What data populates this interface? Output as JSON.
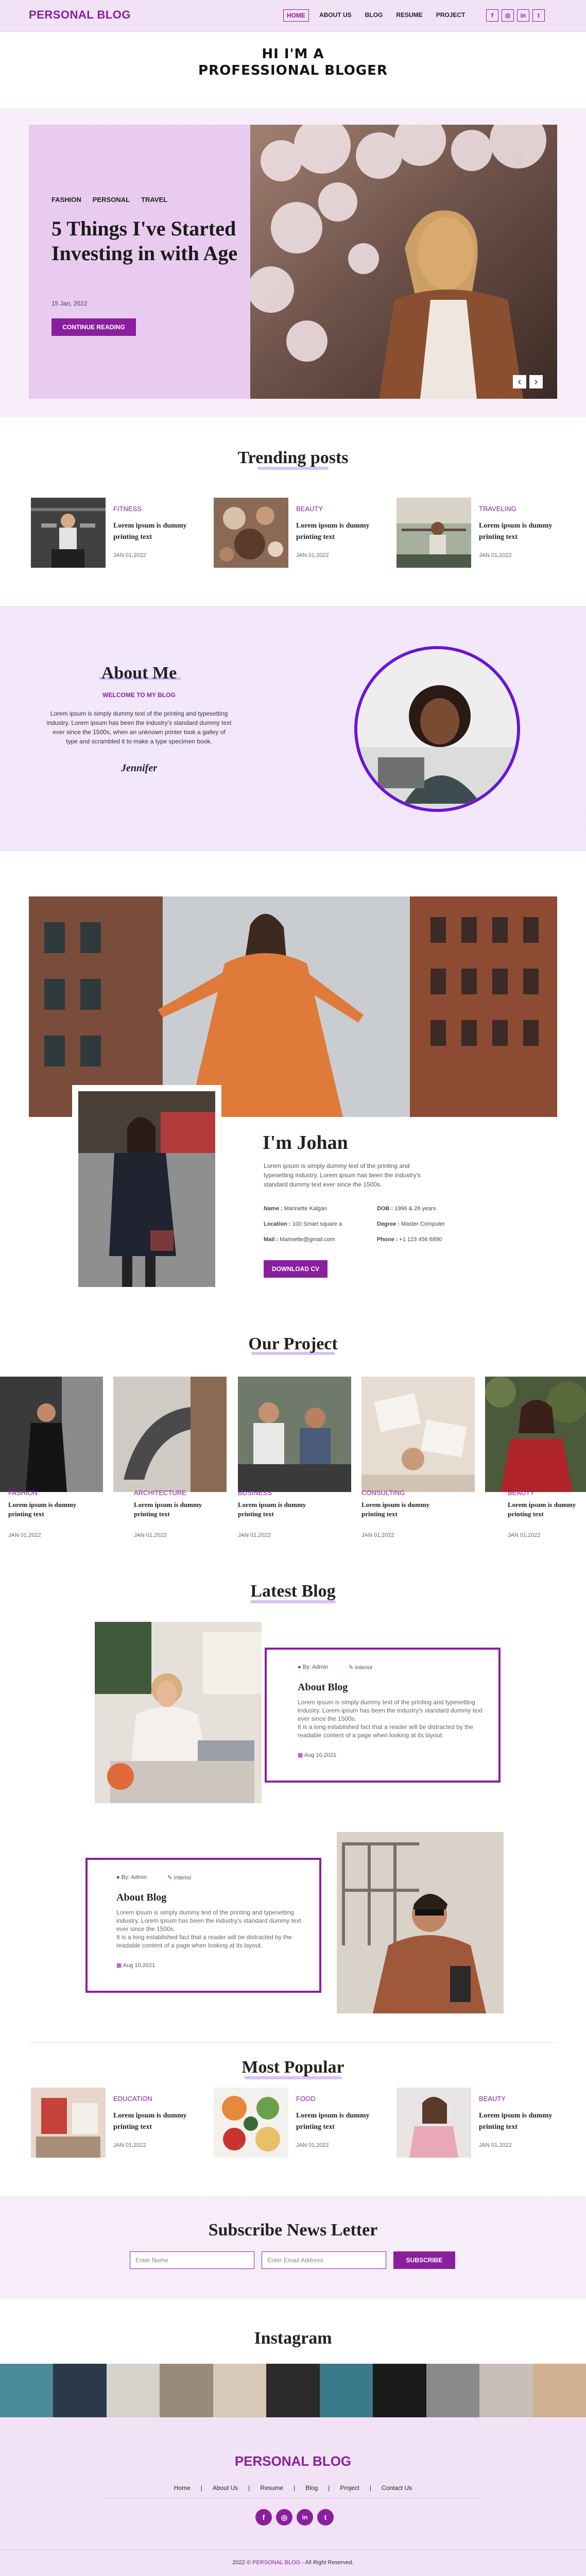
{
  "header": {
    "logo": "PERSONAL BLOG",
    "nav": [
      "HOME",
      "ABOUT US",
      "BLOG",
      "RESUME",
      "PROJECT"
    ],
    "social": [
      "f",
      "◎",
      "in",
      "t"
    ]
  },
  "intro": {
    "line1": "HI I'M A",
    "line2": "PROFESSIONAL BLOGER"
  },
  "hero": {
    "tags": [
      "FASHION",
      "PERSONAL",
      "TRAVEL"
    ],
    "title": "5 Things I've Started Investing in with Age",
    "date": "15 Jan, 2022",
    "button": "CONTINUE READING",
    "prev": "‹",
    "next": "›"
  },
  "trending": {
    "title": "Trending posts",
    "posts": [
      {
        "category": "FITNESS",
        "title": "Lorem ipsum is dummy printing text",
        "date": "JAN 01,2022"
      },
      {
        "category": "BEAUTY",
        "title": "Lorem ipsum is dummy printing text",
        "date": "JAN 01,2022"
      },
      {
        "category": "TRAVELING",
        "title": "Lorem ipsum is dummy printing text",
        "date": "JAN 01,2022"
      }
    ]
  },
  "about": {
    "title": "About Me",
    "subtitle": "WELCOME TO MY BLOG",
    "text": "Lorem ipsum is simply dummy text of the printing and typesetting industry. Lorem ipsum has been the industry's standard dummy text ever since the 1500s, when an unknown printer took a galley of type and scrambled it to make a type specimen book.",
    "signature": "Jennifer"
  },
  "resume": {
    "name": "I'm Johan",
    "text": "Lorem ipsum is simply dummy text of the printing and typesetting industry. Lorem ipsum has been the industry's standard dummy text ever since the 1500s.",
    "fields": [
      {
        "label": "Name :",
        "value": "Marinette Kalgan"
      },
      {
        "label": "DOB :",
        "value": "1996 & 26 years"
      },
      {
        "label": "Location :",
        "value": "100 Smart square a"
      },
      {
        "label": "Degree :",
        "value": "Master Computer"
      },
      {
        "label": "Mail :",
        "value": "Marinette@gmail.com"
      },
      {
        "label": "Phone :",
        "value": "+1 123 456 6890"
      }
    ],
    "button": "DOWNLOAD CV"
  },
  "project": {
    "title": "Our Project",
    "items": [
      {
        "category": "FASHION",
        "title": "Lorem ipsum is dummy printing text",
        "date": "JAN 01,2022"
      },
      {
        "category": "Architecture",
        "title": "Lorem ipsum is dummy printing text",
        "date": "JAN 01,2022"
      },
      {
        "category": "BUSINESS",
        "title": "Lorem ipsum is dummy printing text",
        "date": "JAN 01,2022"
      },
      {
        "category": "CONSULTING",
        "title": "Lorem ipsum is dummy printing text",
        "date": "JAN 01,2022"
      },
      {
        "category": "BEAUTY",
        "title": "Lorem ipsum is dummy printing text",
        "date": "JAN 01,2022"
      }
    ]
  },
  "latest": {
    "title": "Latest Blog",
    "posts": [
      {
        "author": "By: Admin",
        "tag": "Interior",
        "title": "About Blog",
        "text": "Lorem ipsum is simply dummy text of the printing and typesetting industry. Lorem ipsum has been the industry's standard dummy text ever since the 1500s.",
        "text2": "It is a long established fact that a reader will be distracted by the readable content of a page when looking at its layout.",
        "date": "Aug 10,2021"
      },
      {
        "author": "By: Admin",
        "tag": "Interior",
        "title": "About Blog",
        "text": "Lorem ipsum is simply dummy text of the printing and typesetting industry. Lorem ipsum has been the industry's standard dummy text ever since the 1500s.",
        "text2": "It is a long established fact that a reader will be distracted by the readable content of a page when looking at its layout.",
        "date": "Aug 10,2021"
      }
    ]
  },
  "popular": {
    "title": "Most Popular",
    "posts": [
      {
        "category": "EDUCATION",
        "title": "Lorem ipsum is dummy printing text",
        "date": "JAN 01,2022"
      },
      {
        "category": "FOOD",
        "title": "Lorem ipsum is dummy printing text",
        "date": "JAN 01,2022"
      },
      {
        "category": "BEAUTY",
        "title": "Lorem ipsum is dummy printing text",
        "date": "JAN 01,2022"
      }
    ]
  },
  "subscribe": {
    "title": "Subscribe News Letter",
    "name_placeholder": "Enter Name",
    "email_placeholder": "Enter Email Address",
    "button": "SUBSCRIBE"
  },
  "instagram": {
    "title": "Instagram"
  },
  "footer": {
    "logo": "PERSONAL BLOG",
    "links": [
      "Home",
      "About Us",
      "Resume",
      "Blog",
      "Project",
      "Contact Us"
    ],
    "copyright_pre": "2022 © ",
    "copyright_brand": "PERSONAL BLOG",
    "copyright_post": " - All Right Reserved."
  },
  "colors": {
    "accent": "#8a1f9e",
    "light": "#f2e2f6",
    "violet": "#6a14d6"
  }
}
